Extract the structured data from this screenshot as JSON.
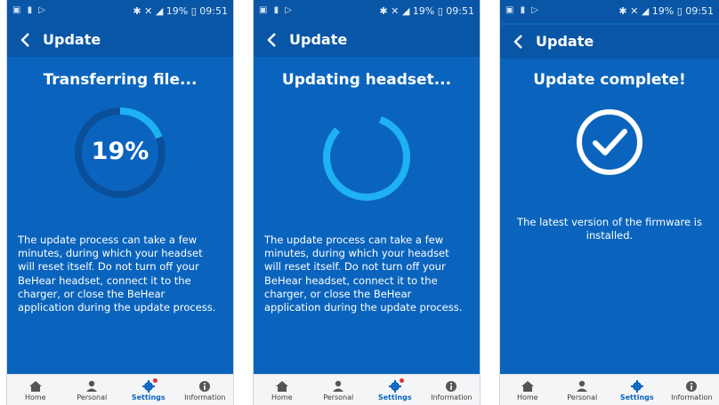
{
  "colors": {
    "panel": "#0a64bd",
    "bar": "#0a56a6",
    "accent": "#1fb2f2",
    "ring_track": "#0a4f99"
  },
  "status": {
    "time": "09:51",
    "battery": "19%"
  },
  "nav": [
    {
      "label": "Home",
      "icon": "home-icon"
    },
    {
      "label": "Personal",
      "icon": "person-icon"
    },
    {
      "label": "Settings",
      "icon": "gear-icon"
    },
    {
      "label": "Information",
      "icon": "info-icon"
    }
  ],
  "screens": [
    {
      "title": "Update",
      "heading": "Transferring file...",
      "progress_percent": 19,
      "progress_label": "19%",
      "message": "The update process can take a few minutes, during which your headset will reset itself. Do not turn off your BeHear headset, connect it to the charger, or close the BeHear application during the update process."
    },
    {
      "title": "Update",
      "heading": "Updating headset...",
      "message": "The update process can take a few minutes, during which your headset will reset itself. Do not turn off your BeHear headset, connect it to the charger, or close the BeHear application during the update process."
    },
    {
      "title": "Update",
      "heading": "Update complete!",
      "message": "The latest version of the firmware is installed."
    }
  ]
}
